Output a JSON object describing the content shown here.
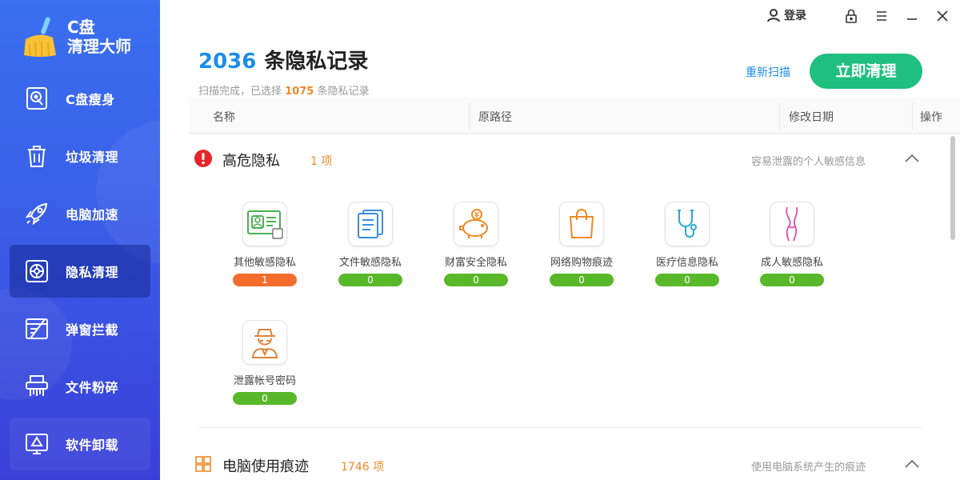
{
  "app": {
    "title_line1": "C盘",
    "title_line2": "清理大师"
  },
  "sidebar": {
    "items": [
      {
        "label": "C盘瘦身",
        "icon": "disk-icon"
      },
      {
        "label": "垃圾清理",
        "icon": "trash-icon"
      },
      {
        "label": "电脑加速",
        "icon": "rocket-icon"
      },
      {
        "label": "隐私清理",
        "icon": "privacy-icon",
        "active": true
      },
      {
        "label": "弹窗拦截",
        "icon": "popup-block-icon"
      },
      {
        "label": "文件粉碎",
        "icon": "shredder-icon"
      },
      {
        "label": "软件卸载",
        "icon": "uninstall-icon"
      }
    ]
  },
  "topbar": {
    "login_label": "登录"
  },
  "header": {
    "count": "2036",
    "title": "条隐私记录",
    "subtitle_prefix": "扫描完成，已选择",
    "selected": "1075",
    "subtitle_suffix": "条隐私记录",
    "rescan_label": "重新扫描",
    "clean_label": "立即清理"
  },
  "table": {
    "columns": [
      "名称",
      "原路径",
      "修改日期",
      "操作"
    ]
  },
  "sections": [
    {
      "title": "高危隐私",
      "count": "1 项",
      "desc": "容易泄露的个人敏感信息",
      "icon": "alert-icon",
      "items": [
        {
          "label": "其他敏感隐私",
          "value": "1",
          "icon": "id-card-icon",
          "hot": true
        },
        {
          "label": "文件敏感隐私",
          "value": "0",
          "icon": "document-icon"
        },
        {
          "label": "财富安全隐私",
          "value": "0",
          "icon": "piggy-bank-icon"
        },
        {
          "label": "网络购物痕迹",
          "value": "0",
          "icon": "shopping-bag-icon"
        },
        {
          "label": "医疗信息隐私",
          "value": "0",
          "icon": "stethoscope-icon"
        },
        {
          "label": "成人敏感隐私",
          "value": "0",
          "icon": "adult-icon"
        },
        {
          "label": "泄露帐号密码",
          "value": "0",
          "icon": "spy-icon"
        }
      ]
    },
    {
      "title": "电脑使用痕迹",
      "count": "1746 项",
      "desc": "使用电脑系统产生的痕迹",
      "icon": "windows-icon"
    }
  ],
  "colors": {
    "accent_blue": "#1a8ee8",
    "clean_green": "#1fc07f",
    "badge_green": "#59b82a",
    "badge_orange": "#f46d2d",
    "count_orange": "#f08a24",
    "sidebar_top": "#3a6ff0",
    "sidebar_bottom": "#3a3fd8"
  }
}
